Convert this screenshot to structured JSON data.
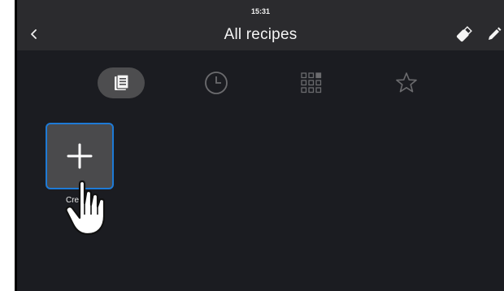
{
  "status": {
    "time": "15:31"
  },
  "header": {
    "title": "All recipes",
    "back_icon": "chevron-left-icon",
    "actions": [
      {
        "icon": "usb-stick-icon"
      },
      {
        "icon": "pencil-icon"
      }
    ]
  },
  "tabs": [
    {
      "icon": "recipe-book-icon",
      "active": true
    },
    {
      "icon": "clock-icon",
      "active": false
    },
    {
      "icon": "grid-icon",
      "active": false
    },
    {
      "icon": "star-icon",
      "active": false
    }
  ],
  "tiles": [
    {
      "icon": "plus-icon",
      "label": "Create recipe",
      "visible_label": "Crea t e"
    }
  ],
  "colors": {
    "header_bg": "#2b2b2e",
    "content_bg": "#1b1c21",
    "accent": "#1e7ad6",
    "tile_bg": "#4a4a4c",
    "active_tab_bg": "#4d4d4f"
  }
}
